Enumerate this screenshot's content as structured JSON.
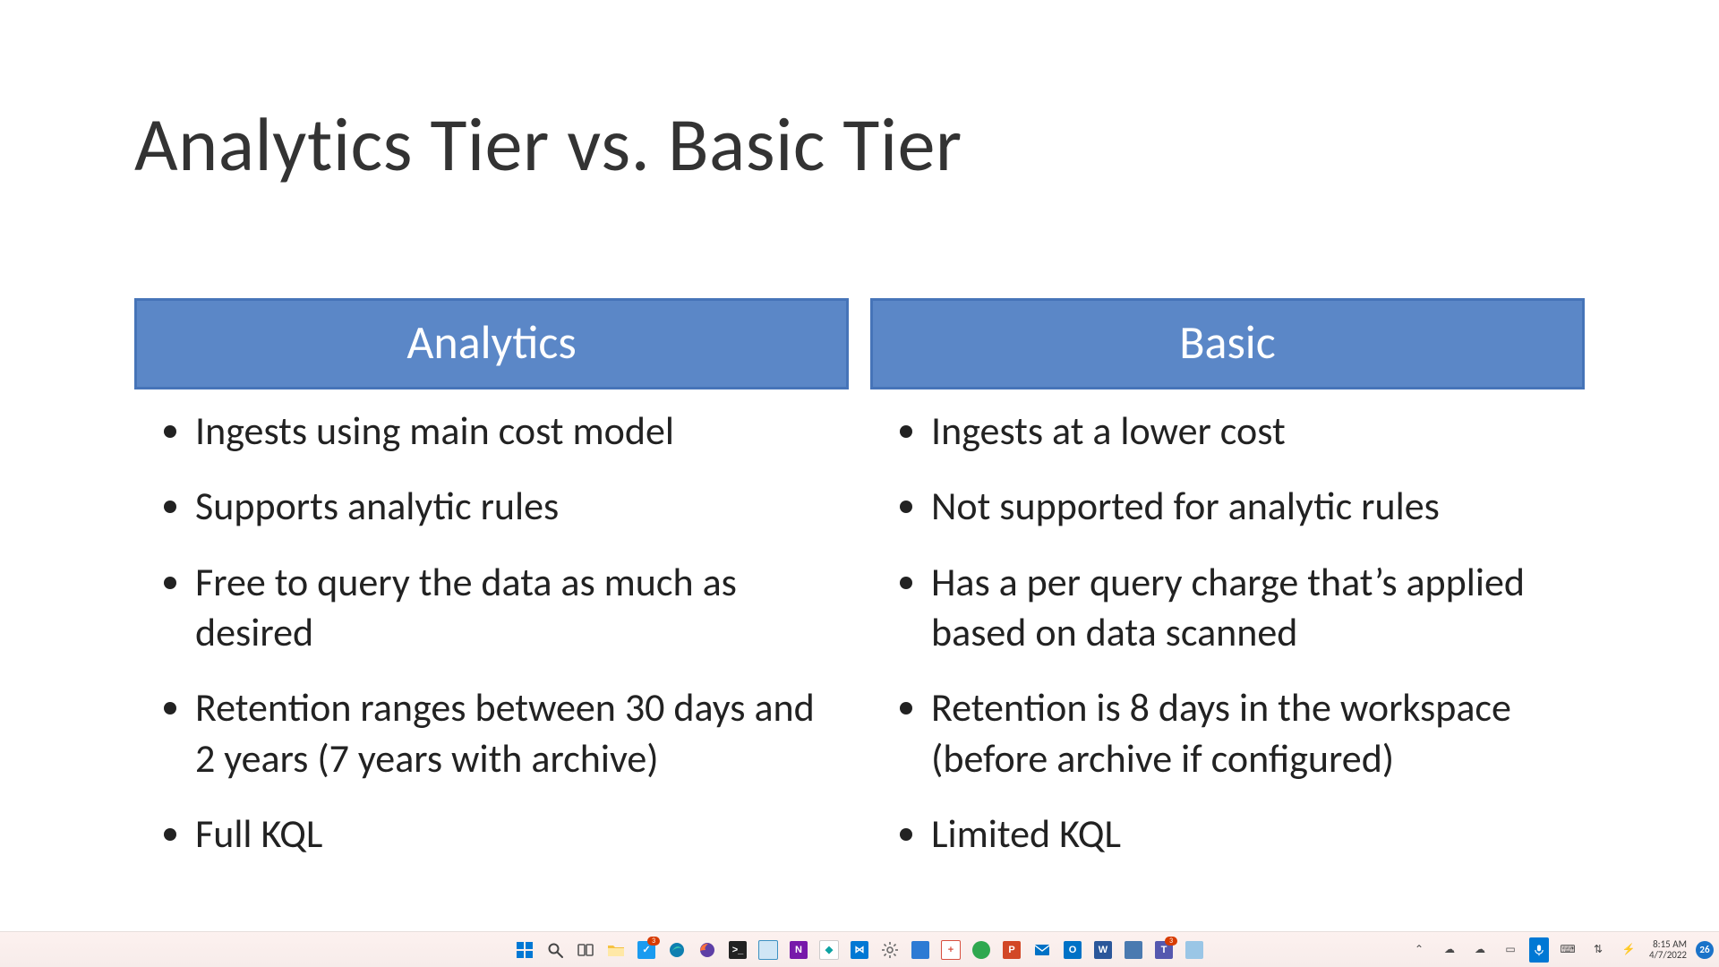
{
  "slide": {
    "title": "Analytics Tier vs. Basic Tier",
    "accent": "#5b87c7",
    "columns": [
      {
        "header": "Analytics",
        "bullets": [
          "Ingests using main cost model",
          "Supports analytic rules",
          "Free to query the data as much as desired",
          "Retention ranges between 30 days and 2 years (7 years with archive)",
          "Full KQL"
        ]
      },
      {
        "header": "Basic",
        "bullets": [
          "Ingests at a lower cost",
          "Not supported for analytic rules",
          "Has a per query charge that’s applied based on data scanned",
          "Retention is 8 days in the workspace (before archive if configured)",
          "Limited KQL"
        ]
      }
    ]
  },
  "taskbar": {
    "time": "8:15 AM",
    "date": "4/7/2022",
    "notification_count": "26",
    "center_apps": [
      {
        "name": "start",
        "color": "#0078d4",
        "letter": ""
      },
      {
        "name": "search",
        "color": "#333333",
        "letter": ""
      },
      {
        "name": "task-view",
        "color": "#575757",
        "letter": ""
      },
      {
        "name": "file-explorer",
        "color": "#f5c242",
        "letter": ""
      },
      {
        "name": "todo",
        "color": "#1a9bf0",
        "letter": "",
        "badge": "3"
      },
      {
        "name": "edge",
        "color": "#0f7fb0",
        "letter": ""
      },
      {
        "name": "firefox",
        "color": "#ff7139",
        "letter": ""
      },
      {
        "name": "terminal",
        "color": "#222222",
        "letter": ""
      },
      {
        "name": "notepad",
        "color": "#3c91c2",
        "letter": ""
      },
      {
        "name": "onenote",
        "color": "#7719aa",
        "letter": "N"
      },
      {
        "name": "power-automate",
        "color": "#0da3a3",
        "letter": ""
      },
      {
        "name": "vscode",
        "color": "#0078d4",
        "letter": ""
      },
      {
        "name": "settings",
        "color": "#6a6a6a",
        "letter": ""
      },
      {
        "name": "photos",
        "color": "#2d7bd4",
        "letter": ""
      },
      {
        "name": "snip",
        "color": "#d85040",
        "letter": ""
      },
      {
        "name": "maps",
        "color": "#2fa84f",
        "letter": ""
      },
      {
        "name": "powerpoint",
        "color": "#d24726",
        "letter": "P"
      },
      {
        "name": "mail",
        "color": "#0072c6",
        "letter": ""
      },
      {
        "name": "outlook",
        "color": "#0072c6",
        "letter": "O"
      },
      {
        "name": "word",
        "color": "#2b579a",
        "letter": "W"
      },
      {
        "name": "calculator",
        "color": "#4a7ab0",
        "letter": ""
      },
      {
        "name": "teams",
        "color": "#5558af",
        "letter": "T",
        "badge": "3"
      },
      {
        "name": "window-swap",
        "color": "#9ac6e6",
        "letter": ""
      }
    ],
    "tray_icons": [
      {
        "name": "show-hidden",
        "glyph": "⌃"
      },
      {
        "name": "onedrive-personal",
        "glyph": "☁"
      },
      {
        "name": "onedrive-work",
        "glyph": "☁"
      },
      {
        "name": "battery",
        "glyph": "▭"
      }
    ],
    "rightmost_tray": [
      {
        "name": "touchkbd",
        "glyph": "⌨"
      },
      {
        "name": "network",
        "glyph": "⇅"
      },
      {
        "name": "power",
        "glyph": "⚡"
      }
    ]
  }
}
